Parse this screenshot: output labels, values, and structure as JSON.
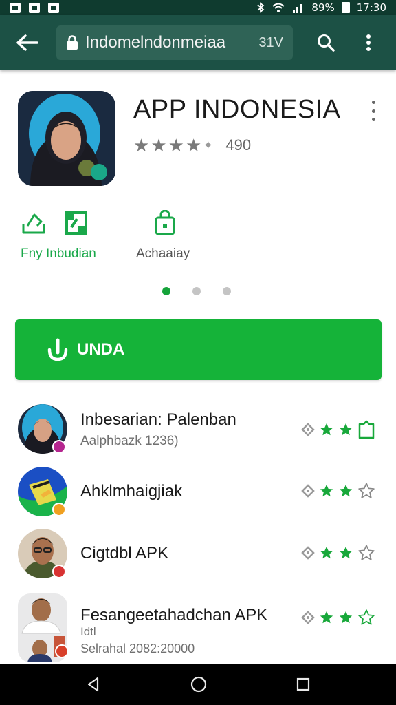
{
  "status_bar": {
    "battery": "89%",
    "time": "17:30"
  },
  "browser": {
    "url": "Indomelndonmeiaa",
    "url_extra": "31V"
  },
  "app": {
    "title": "APP INDONESIA",
    "rating": 4.5,
    "rating_count": "490"
  },
  "actions": [
    {
      "label": "Fny Inbudian"
    },
    {
      "label": "Achaaiay"
    }
  ],
  "pager": {
    "count": 3,
    "active": 0
  },
  "install": {
    "label": "UNDA"
  },
  "list": [
    {
      "title": "Inbesarian: Palenban",
      "subtitle": "Aalphbazk 1236)",
      "badge_color": "#b5268f",
      "stars_filled": 2,
      "stars_total": 3
    },
    {
      "title": "Ahklmhaigjiak",
      "subtitle": "",
      "badge_color": "#f0a020",
      "stars_filled": 2,
      "stars_total": 3
    },
    {
      "title": "Cigtdbl APK",
      "subtitle": "",
      "badge_color": "#d83232",
      "stars_filled": 2,
      "stars_total": 3
    },
    {
      "title": "Fesangeetahadchan APK",
      "subtitle": "Idtl",
      "subtitle2": "Selrahal 2082:20000",
      "badge_color": "#d8402a",
      "stars_filled": 2,
      "stars_total": 3
    }
  ],
  "colors": {
    "accent": "#15b339",
    "toolbar": "#1c5145",
    "status": "#0f3b2f"
  },
  "icons": [
    "back-icon",
    "lock-icon",
    "search-icon",
    "more-vert-icon",
    "share-icon",
    "wishlist-icon",
    "download-icon",
    "nav-back-icon",
    "nav-home-icon",
    "nav-recents-icon"
  ]
}
